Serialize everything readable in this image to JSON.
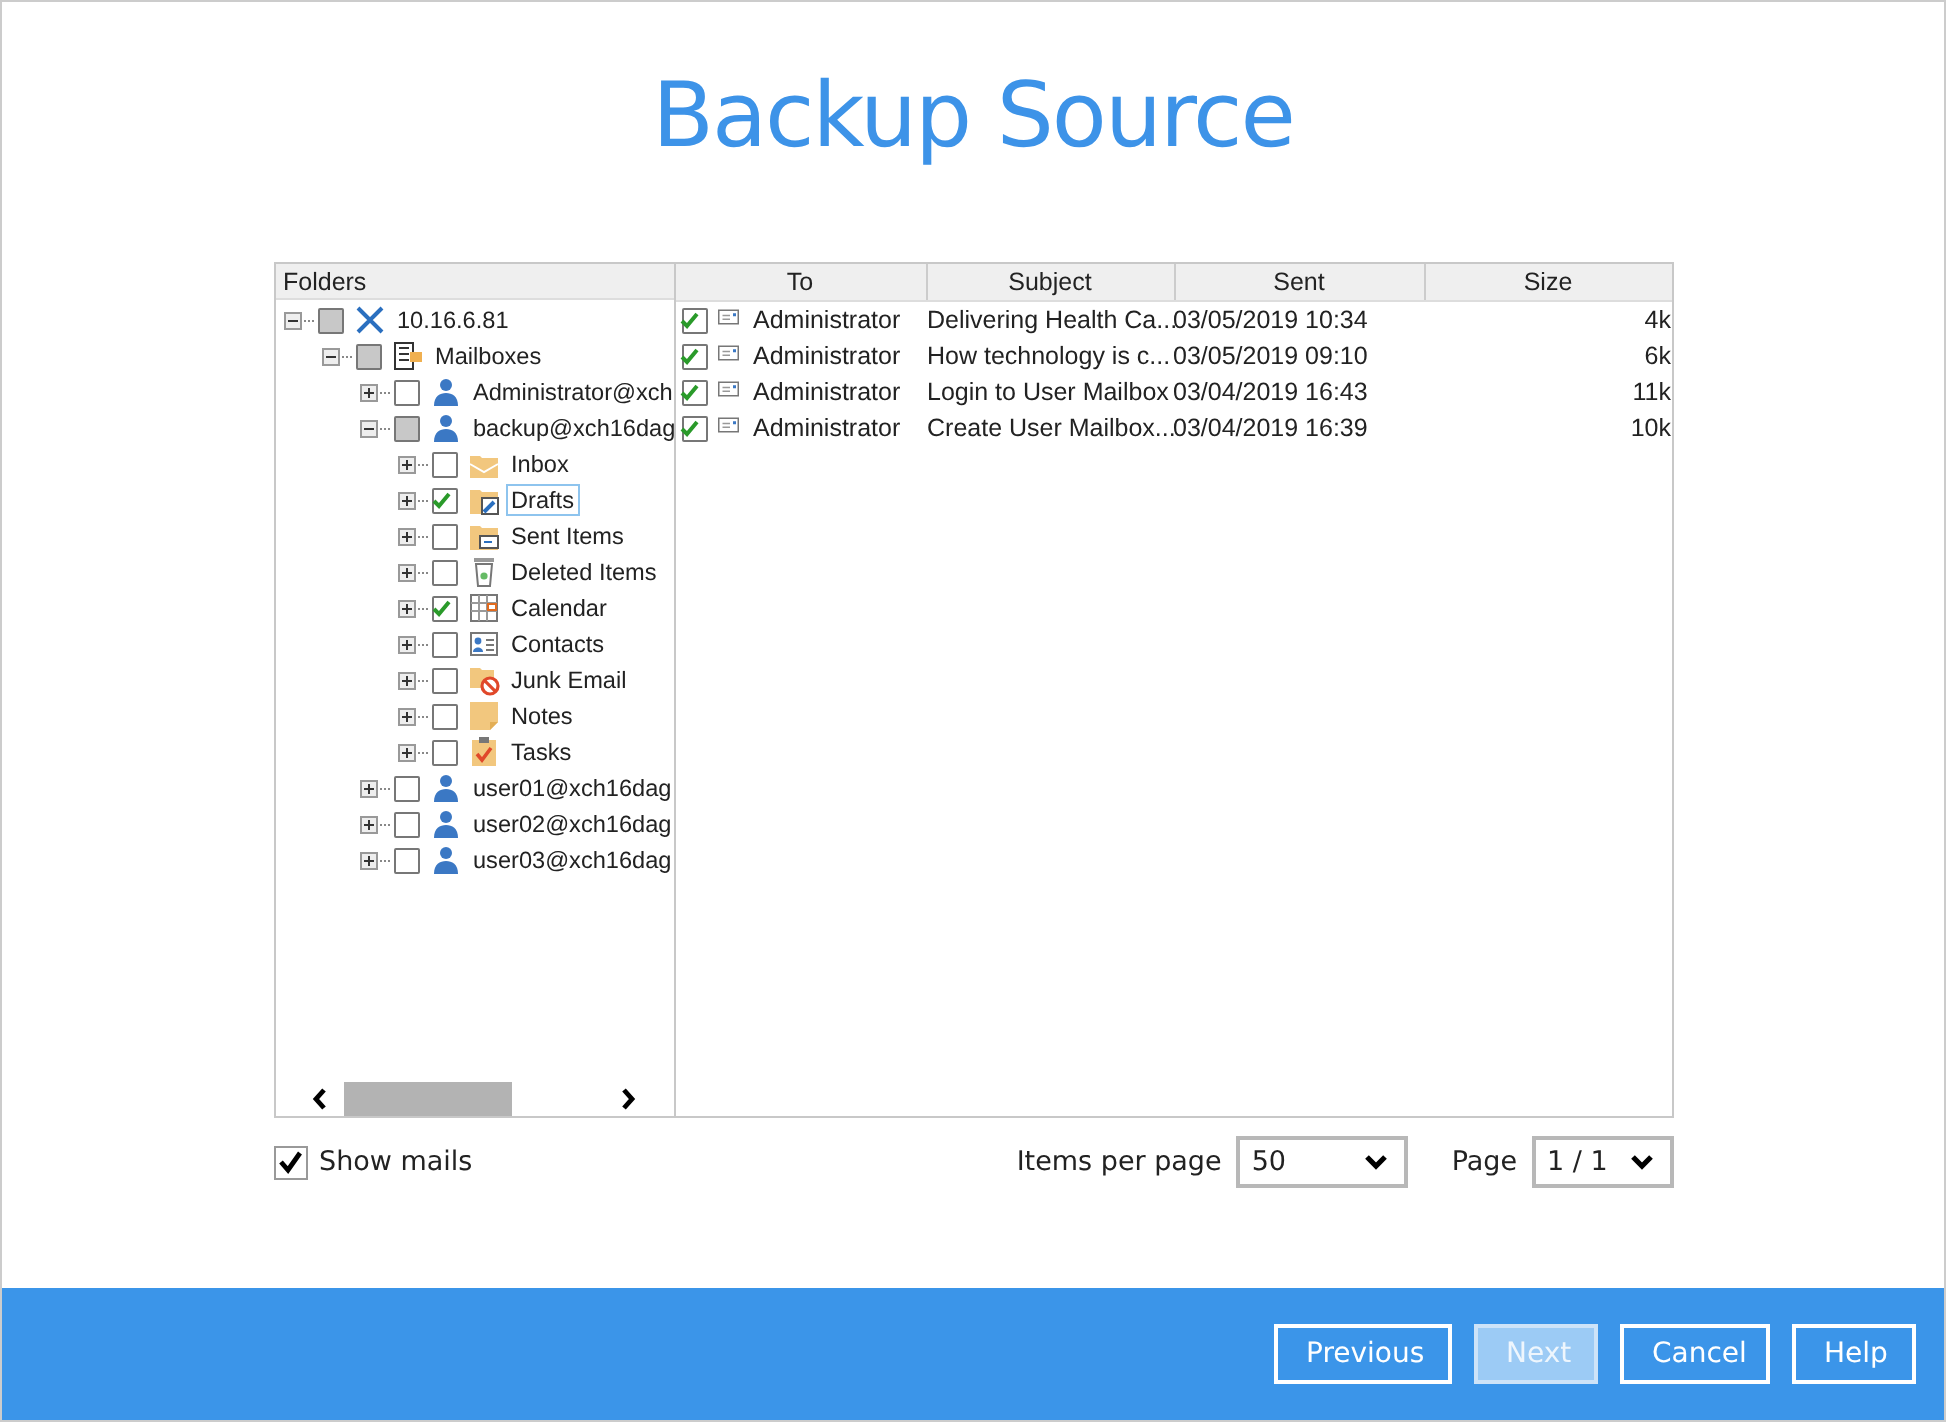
{
  "title": "Backup Source",
  "folders": {
    "header": "Folders",
    "tree": [
      {
        "label": "10.16.6.81",
        "kind": "server",
        "expanded": true,
        "checked": false,
        "partial": true,
        "selected": false,
        "children": [
          {
            "label": "Mailboxes",
            "kind": "mailboxes",
            "expanded": true,
            "checked": false,
            "partial": true,
            "selected": false,
            "children": [
              {
                "label": "Administrator@xch",
                "kind": "user",
                "expanded": false,
                "checked": false,
                "partial": false,
                "selected": false
              },
              {
                "label": "backup@xch16dag",
                "kind": "user",
                "expanded": true,
                "checked": false,
                "partial": true,
                "selected": false,
                "children": [
                  {
                    "label": "Inbox",
                    "kind": "inbox",
                    "expanded": false,
                    "checked": false,
                    "partial": false,
                    "selected": false
                  },
                  {
                    "label": "Drafts",
                    "kind": "drafts",
                    "expanded": false,
                    "checked": true,
                    "partial": false,
                    "selected": true
                  },
                  {
                    "label": "Sent Items",
                    "kind": "sent",
                    "expanded": false,
                    "checked": false,
                    "partial": false,
                    "selected": false
                  },
                  {
                    "label": "Deleted Items",
                    "kind": "deleted",
                    "expanded": false,
                    "checked": false,
                    "partial": false,
                    "selected": false
                  },
                  {
                    "label": "Calendar",
                    "kind": "calendar",
                    "expanded": false,
                    "checked": true,
                    "partial": false,
                    "selected": false
                  },
                  {
                    "label": "Contacts",
                    "kind": "contacts",
                    "expanded": false,
                    "checked": false,
                    "partial": false,
                    "selected": false
                  },
                  {
                    "label": "Junk Email",
                    "kind": "junk",
                    "expanded": false,
                    "checked": false,
                    "partial": false,
                    "selected": false
                  },
                  {
                    "label": "Notes",
                    "kind": "notes",
                    "expanded": false,
                    "checked": false,
                    "partial": false,
                    "selected": false
                  },
                  {
                    "label": "Tasks",
                    "kind": "tasks",
                    "expanded": false,
                    "checked": false,
                    "partial": false,
                    "selected": false
                  }
                ]
              },
              {
                "label": "user01@xch16dag",
                "kind": "user",
                "expanded": false,
                "checked": false,
                "partial": false,
                "selected": false
              },
              {
                "label": "user02@xch16dag",
                "kind": "user",
                "expanded": false,
                "checked": false,
                "partial": false,
                "selected": false
              },
              {
                "label": "user03@xch16dag",
                "kind": "user",
                "expanded": false,
                "checked": false,
                "partial": false,
                "selected": false
              }
            ]
          }
        ]
      }
    ]
  },
  "mails": {
    "columns": [
      "To",
      "Subject",
      "Sent",
      "Size"
    ],
    "rows": [
      {
        "checked": true,
        "to": "Administrator",
        "subject": "Delivering Health Ca...",
        "sent": "03/05/2019 10:34",
        "size": "4k"
      },
      {
        "checked": true,
        "to": "Administrator",
        "subject": "How technology is c...",
        "sent": "03/05/2019 09:10",
        "size": "6k"
      },
      {
        "checked": true,
        "to": "Administrator",
        "subject": "Login to User Mailbox",
        "sent": "03/04/2019 16:43",
        "size": "11k"
      },
      {
        "checked": true,
        "to": "Administrator",
        "subject": "Create User Mailbox...",
        "sent": "03/04/2019 16:39",
        "size": "10k"
      }
    ]
  },
  "show_mails": {
    "label": "Show mails",
    "checked": true
  },
  "items_per_page": {
    "label": "Items per page",
    "value": "50"
  },
  "page": {
    "label": "Page",
    "value": "1 / 1"
  },
  "buttons": [
    {
      "label": "Previous",
      "disabled": false
    },
    {
      "label": "Next",
      "disabled": true
    },
    {
      "label": "Cancel",
      "disabled": false
    },
    {
      "label": "Help",
      "disabled": false
    }
  ]
}
